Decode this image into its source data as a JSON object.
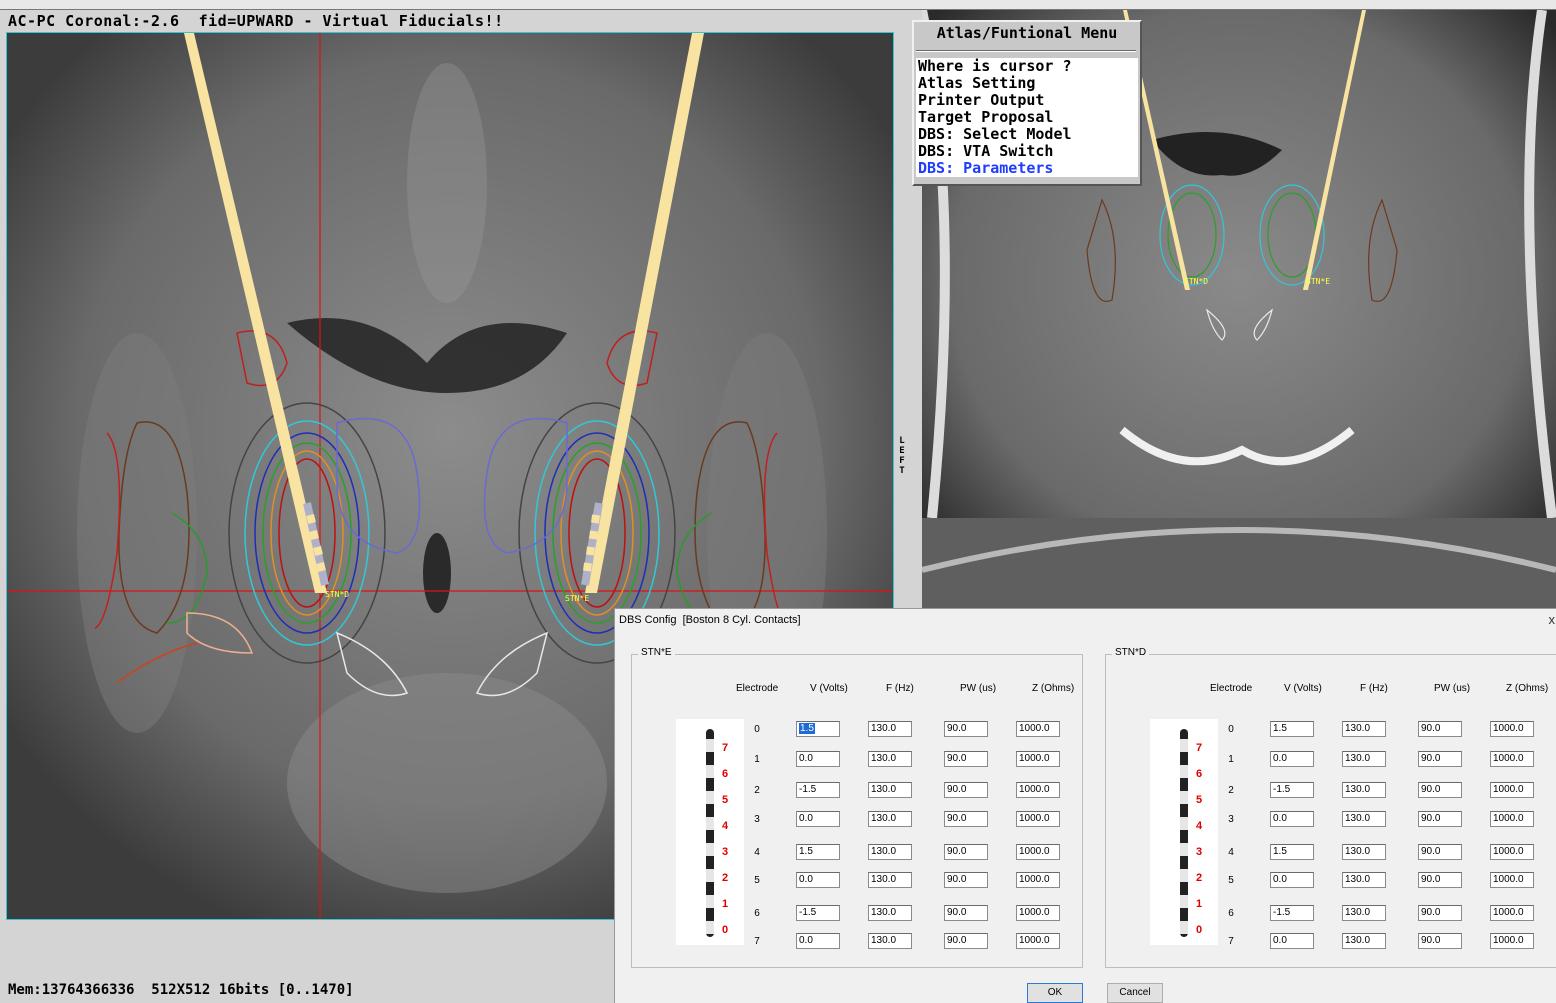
{
  "header": {
    "title": "AC-PC Coronal:-2.6  fid=UPWARD - Virtual Fiducials!!"
  },
  "side_marker": "LEFT",
  "status": {
    "memory": "Mem:13764366336  512X512 16bits [0..1470]"
  },
  "labels": {
    "stn_right": "STN*E",
    "stn_left": "STN*D"
  },
  "atlas_menu": {
    "title": "Atlas/Funtional Menu",
    "items": [
      {
        "label": "Where is cursor ?"
      },
      {
        "label": "Atlas Setting"
      },
      {
        "label": "Printer Output"
      },
      {
        "label": "Target Proposal"
      },
      {
        "label": "DBS: Select Model"
      },
      {
        "label": "DBS: VTA Switch"
      },
      {
        "label": "DBS: Parameters",
        "active": true
      }
    ]
  },
  "dialog": {
    "title": "DBS Config  [Boston 8 Cyl. Contacts]",
    "close": "x",
    "ok_label": "OK",
    "cancel_label": "Cancel",
    "columns": [
      "Electrode",
      "V (Volts)",
      "F (Hz)",
      "PW (us)",
      "Z (Ohms)"
    ],
    "lead_contact_labels": [
      "7",
      "6",
      "5",
      "4",
      "3",
      "2",
      "1",
      "0"
    ],
    "groups": [
      {
        "label": "STN*E",
        "rows": [
          {
            "electrode": "0",
            "v": "1.5",
            "f": "130.0",
            "pw": "90.0",
            "z": "1000.0"
          },
          {
            "electrode": "1",
            "v": "0.0",
            "f": "130.0",
            "pw": "90.0",
            "z": "1000.0"
          },
          {
            "electrode": "2",
            "v": "-1.5",
            "f": "130.0",
            "pw": "90.0",
            "z": "1000.0"
          },
          {
            "electrode": "3",
            "v": "0.0",
            "f": "130.0",
            "pw": "90.0",
            "z": "1000.0"
          },
          {
            "electrode": "4",
            "v": "1.5",
            "f": "130.0",
            "pw": "90.0",
            "z": "1000.0"
          },
          {
            "electrode": "5",
            "v": "0.0",
            "f": "130.0",
            "pw": "90.0",
            "z": "1000.0"
          },
          {
            "electrode": "6",
            "v": "-1.5",
            "f": "130.0",
            "pw": "90.0",
            "z": "1000.0"
          },
          {
            "electrode": "7",
            "v": "0.0",
            "f": "130.0",
            "pw": "90.0",
            "z": "1000.0"
          }
        ]
      },
      {
        "label": "STN*D",
        "rows": [
          {
            "electrode": "0",
            "v": "1.5",
            "f": "130.0",
            "pw": "90.0",
            "z": "1000.0"
          },
          {
            "electrode": "1",
            "v": "0.0",
            "f": "130.0",
            "pw": "90.0",
            "z": "1000.0"
          },
          {
            "electrode": "2",
            "v": "-1.5",
            "f": "130.0",
            "pw": "90.0",
            "z": "1000.0"
          },
          {
            "electrode": "3",
            "v": "0.0",
            "f": "130.0",
            "pw": "90.0",
            "z": "1000.0"
          },
          {
            "electrode": "4",
            "v": "1.5",
            "f": "130.0",
            "pw": "90.0",
            "z": "1000.0"
          },
          {
            "electrode": "5",
            "v": "0.0",
            "f": "130.0",
            "pw": "90.0",
            "z": "1000.0"
          },
          {
            "electrode": "6",
            "v": "-1.5",
            "f": "130.0",
            "pw": "90.0",
            "z": "1000.0"
          },
          {
            "electrode": "7",
            "v": "0.0",
            "f": "130.0",
            "pw": "90.0",
            "z": "1000.0"
          }
        ]
      }
    ]
  }
}
